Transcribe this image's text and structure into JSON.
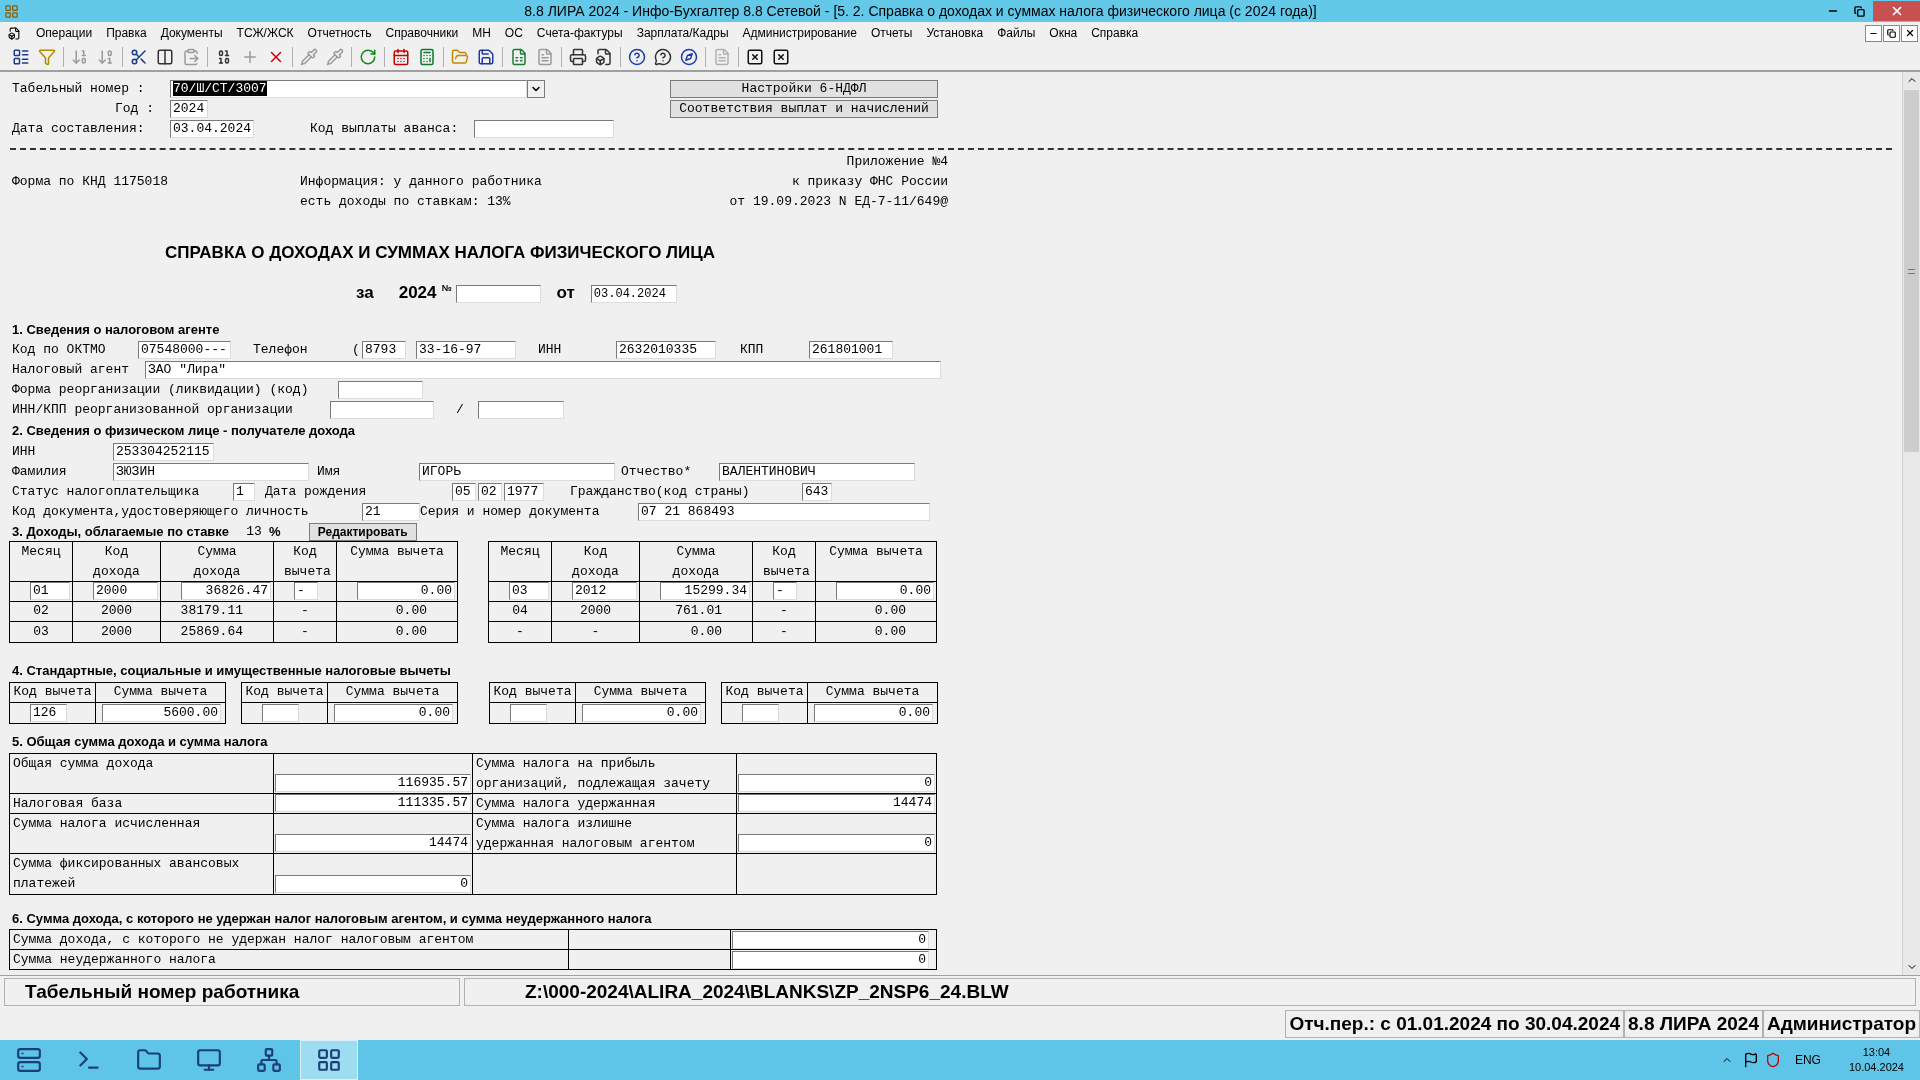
{
  "window": {
    "title": "8.8 ЛИРА 2024 - Инфо-Бухгалтер 8.8 Сетевой - [5.  2. Справка о доходах и суммах налога физического лица (с 2024 года)]"
  },
  "menu": [
    "Операции",
    "Правка",
    "Документы",
    "ТСЖ/ЖСК",
    "Отчетность",
    "Справочники",
    "МН",
    "ОС",
    "Счета-фактуры",
    "Зарплата/Кадры",
    "Администрирование",
    "Отчеты",
    "Установка",
    "Файлы",
    "Окна",
    "Справка"
  ],
  "header": {
    "tab_number": {
      "label": "Табельный номер :",
      "value": "70/Ш/СТ/3007",
      "selected": true
    },
    "year": {
      "label": "Год :",
      "value": "2024"
    },
    "date": {
      "label": "Дата составления:",
      "value": "03.04.2024"
    },
    "advance_code": {
      "label": "Код выплаты аванса:"
    },
    "buttons": [
      "Настройки 6-НДФЛ",
      "Соответствия выплат и начислений"
    ]
  },
  "form_info": {
    "knd": "Форма по КНД 1175018",
    "info": [
      "Информация: у данного работника",
      "есть доходы по ставкам: 13%"
    ],
    "appendix": [
      "Приложение №4",
      "к приказу ФНС России",
      "от 19.09.2023 N ЕД-7-11/649@"
    ]
  },
  "document": {
    "title": "СПРАВКА О ДОХОДАХ И СУММАХ НАЛОГА ФИЗИЧЕСКОГО ЛИЦА",
    "for_label": "за",
    "year": "2024",
    "number_label": "№",
    "from_label": "от",
    "date": "03.04.2024"
  },
  "section1": {
    "heading": "1. Сведения о налоговом агенте",
    "oktmo": {
      "label": "Код по ОКТМО",
      "value": "07548000---"
    },
    "phone": {
      "label": "Телефон",
      "open": "(",
      "code": "8793",
      "number": "33-16-97"
    },
    "inn": {
      "label": "ИНН",
      "value": "2632010335"
    },
    "kpp": {
      "label": "КПП",
      "value": "261801001"
    },
    "agent": {
      "label": "Налоговый агент",
      "value": "ЗАО \"Лира\""
    },
    "reorg_form": {
      "label": "Форма реорганизации (ликвидации) (код)"
    },
    "reorg_inn_kpp": {
      "label": "ИНН/КПП реорганизованной организации",
      "separator": "/"
    }
  },
  "section2": {
    "heading": "2. Сведения о физическом лице - получателе дохода",
    "inn": {
      "label": "ИНН",
      "value": "253304252115"
    },
    "surname": {
      "label": "Фамилия",
      "value": "ЗЮЗИН"
    },
    "name": {
      "label": "Имя",
      "value": "ИГОРЬ"
    },
    "patronymic": {
      "label": "Отчество*",
      "value": "ВАЛЕНТИНОВИЧ"
    },
    "status": {
      "label": "Статус налогоплательщика",
      "value": "1"
    },
    "birth_date": {
      "label": "Дата рождения",
      "day": "05",
      "month": "02",
      "year": "1977"
    },
    "citizenship": {
      "label": "Гражданство(код страны)",
      "value": "643"
    },
    "doc_code": {
      "label": "Код документа,удостоверяющего личность",
      "value": "21"
    },
    "doc_number": {
      "label": "Серия и номер документа",
      "value": "07 21 868493"
    }
  },
  "section3": {
    "heading": "3. Доходы,  облагаемые по ставке",
    "rate": "13",
    "percent": "%",
    "edit_button": "Редактировать",
    "tables": [
      {
        "columns": [
          "Месяц",
          "Код дохода",
          "Сумма дохода",
          "Код вычета",
          "Сумма вычета"
        ],
        "rows": [
          {
            "current": true,
            "cells": [
              "01",
              "2000",
              "36826.47",
              "-",
              "0.00"
            ]
          },
          {
            "current": false,
            "cells": [
              "02",
              "2000",
              "38179.11",
              "-",
              "0.00"
            ]
          },
          {
            "current": false,
            "cells": [
              "03",
              "2000",
              "25869.64",
              "-",
              "0.00"
            ]
          }
        ]
      },
      {
        "columns": [
          "Месяц",
          "Код дохода",
          "Сумма дохода",
          "Код вычета",
          "Сумма вычета"
        ],
        "rows": [
          {
            "current": true,
            "cells": [
              "03",
              "2012",
              "15299.34",
              "-",
              "0.00"
            ]
          },
          {
            "current": false,
            "cells": [
              "04",
              "2000",
              "761.01",
              "-",
              "0.00"
            ]
          },
          {
            "current": false,
            "cells": [
              "-",
              "-",
              "0.00",
              "-",
              "0.00"
            ]
          }
        ]
      }
    ]
  },
  "section4": {
    "heading": "4. Стандартные,  социальные  и  имущественные  налоговые вычеты",
    "tables": [
      {
        "columns": [
          "Код вычета",
          "Сумма вычета"
        ],
        "code": "126",
        "amount": "5600.00"
      },
      {
        "columns": [
          "Код вычета",
          "Сумма вычета"
        ],
        "amount": "0.00"
      },
      {
        "columns": [
          "Код вычета",
          "Сумма вычета"
        ],
        "amount": "0.00"
      },
      {
        "columns": [
          "Код вычета",
          "Сумма вычета"
        ],
        "amount": "0.00"
      }
    ]
  },
  "section5": {
    "heading": "5. Общая сумма дохода и сумма налога",
    "left": [
      {
        "label": "Общая сумма дохода",
        "value": "116935.57"
      },
      {
        "label": "Налоговая база",
        "value": "111335.57"
      },
      {
        "label": "Сумма налога исчисленная",
        "value": "14474"
      },
      {
        "label": "Сумма фиксированных авансовых платежей",
        "value": "0"
      }
    ],
    "right": [
      {
        "label": "Сумма налога на прибыль организаций, подлежащая зачету",
        "value": "0"
      },
      {
        "label": "Сумма налога удержанная",
        "value": "14474"
      },
      {
        "label": "Сумма налога излишне удержанная налоговым агентом",
        "value": "0"
      }
    ]
  },
  "section6": {
    "heading": "6. Сумма дохода, с которого не удержан налог налоговым агентом, и сумма неудержанного налога",
    "rows": [
      {
        "label": "Сумма дохода, с которого не удержан налог налоговым агентом",
        "value": "0"
      },
      {
        "label": "Сумма неудержанного налога",
        "value": "0"
      }
    ]
  },
  "status_bar": {
    "hint": "Табельный номер работника",
    "file": "Z:\\000-2024\\ALIRA_2024\\BLANKS\\ZP_2NSP6_24.BLW",
    "period": "Отч.пер.: с 01.01.2024 по 30.04.2024",
    "product": "8.8 ЛИРА 2024",
    "user": "Администратор"
  },
  "taskbar": {
    "apps": [
      {
        "selected": false
      },
      {
        "selected": false
      },
      {
        "selected": false
      },
      {
        "selected": false
      },
      {
        "selected": false
      },
      {
        "selected": true
      }
    ],
    "language": "ENG",
    "time": "13:04",
    "date": "10.04.2024"
  }
}
